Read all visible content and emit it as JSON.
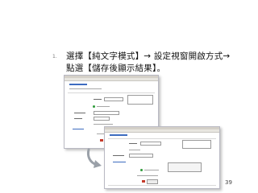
{
  "slide": {
    "step_number": "1.",
    "instruction_line_1": "選擇【純文字模式】→ 設定視窗開啟方式→",
    "instruction_line_2": "點選【儲存後顯示結果】。",
    "page_number": "39"
  },
  "colors": {
    "text": "#111111",
    "screenshot_border": "#b9b9c3",
    "link_blue": "#3d6cc0",
    "arrow_gray": "#9aa0a8"
  }
}
